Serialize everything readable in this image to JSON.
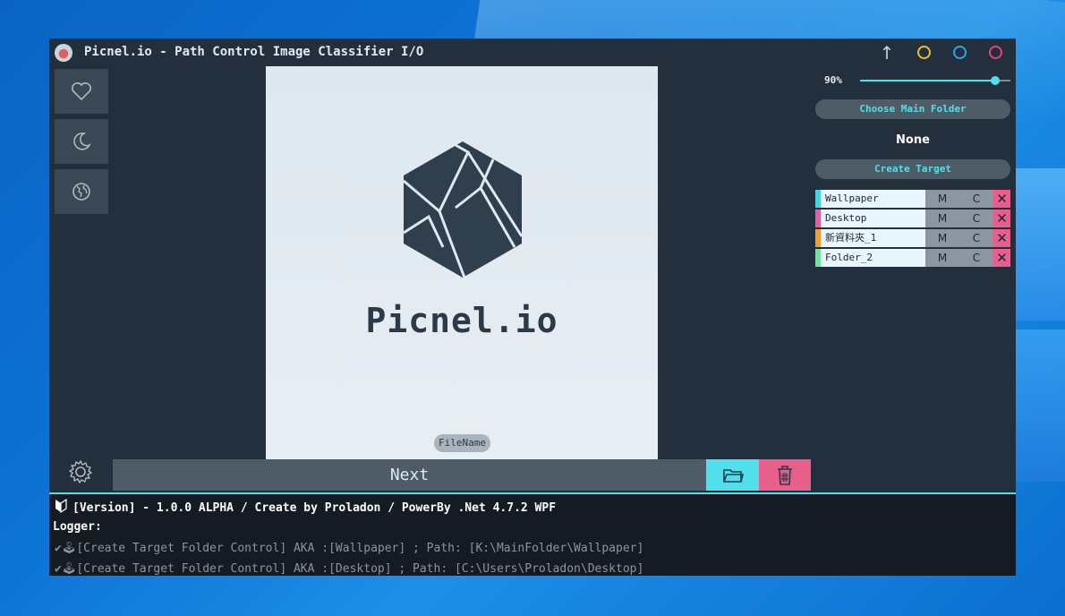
{
  "window": {
    "title": "Picnel.io - Path Control Image Classifier I/O",
    "ring_colors": [
      "#e2c13a",
      "#2aa7e0",
      "#e0457b"
    ]
  },
  "sidebar": {
    "items": [
      {
        "icon": "heart-icon"
      },
      {
        "icon": "moon-icon"
      },
      {
        "icon": "globe-icon"
      }
    ]
  },
  "preview": {
    "brand": "Picnel.io",
    "filename": "FileName"
  },
  "actions": {
    "next_label": "Next",
    "open_icon": "folder-open-icon",
    "delete_icon": "trash-icon"
  },
  "right_panel": {
    "zoom": "90%",
    "zoom_value": 0.9,
    "choose_folder_label": "Choose Main Folder",
    "main_folder": "None",
    "create_target_label": "Create Target",
    "targets": [
      {
        "name": "Wallpaper",
        "color": "#3fd6e4",
        "move": "M",
        "copy": "C",
        "delete": "✕"
      },
      {
        "name": "Desktop",
        "color": "#e060a8",
        "move": "M",
        "copy": "C",
        "delete": "✕"
      },
      {
        "name": "新資料夾_1",
        "color": "#f0a030",
        "move": "M",
        "copy": "C",
        "delete": "✕"
      },
      {
        "name": "Folder_2",
        "color": "#6fe39a",
        "move": "M",
        "copy": "C",
        "delete": "✕"
      }
    ]
  },
  "log": {
    "version": "[Version] - 1.0.0 ALPHA / Create by Proladon / PowerBy .Net 4.7.2 WPF",
    "logger_label": "Logger:",
    "lines": [
      "[Create Target Folder Control] AKA :[Wallpaper] ; Path: [K:\\MainFolder\\Wallpaper]",
      "[Create Target Folder Control] AKA :[Desktop] ; Path: [C:\\Users\\Proladon\\Desktop]"
    ]
  }
}
